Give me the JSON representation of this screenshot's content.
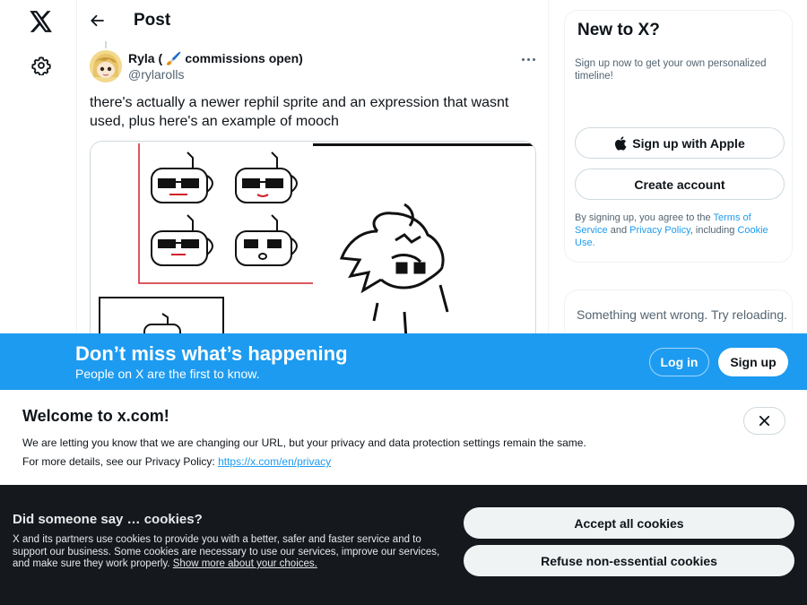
{
  "nav": {
    "logo_icon": "x-logo-icon",
    "settings_icon": "gear-icon"
  },
  "header": {
    "back_icon": "arrow-left-icon",
    "title": "Post"
  },
  "post": {
    "author_name": "Ryla ( 🖌️ commissions open)",
    "author_handle": "@rylarolls",
    "text": "there's actually a newer rephil sprite and an expression that wasnt used, plus here's an example of mooch",
    "media_description_icon": "image-icon"
  },
  "sidebar": {
    "signup_title": "New to X?",
    "signup_subtitle": "Sign up now to get your own personalized timeline!",
    "apple_button": "Sign up with Apple",
    "create_account_button": "Create account",
    "terms_prefix": "By signing up, you agree to the ",
    "terms_link": "Terms of Service",
    "terms_and": " and ",
    "privacy_link": "Privacy Policy",
    "terms_including": ", including ",
    "cookie_link": "Cookie Use.",
    "error_text": "Something went wrong. Try reloading."
  },
  "banner": {
    "title": "Don’t miss what’s happening",
    "subtitle": "People on X are the first to know.",
    "login": "Log in",
    "signup": "Sign up",
    "color": "#1d9bf0"
  },
  "welcome": {
    "title": "Welcome to x.com!",
    "line1": "We are letting you know that we are changing our URL, but your privacy and data protection settings remain the same.",
    "line2_prefix": "For more details, see our Privacy Policy: ",
    "line2_link": "https://x.com/en/privacy"
  },
  "cookies": {
    "title": "Did someone say … cookies?",
    "body": "X and its partners use cookies to provide you with a better, safer and faster service and to support our business. Some cookies are necessary to use our services, improve our services, and make sure they work properly. ",
    "body_link": "Show more about your choices.",
    "accept": "Accept all cookies",
    "refuse": "Refuse non-essential cookies",
    "background": "#15191e"
  }
}
